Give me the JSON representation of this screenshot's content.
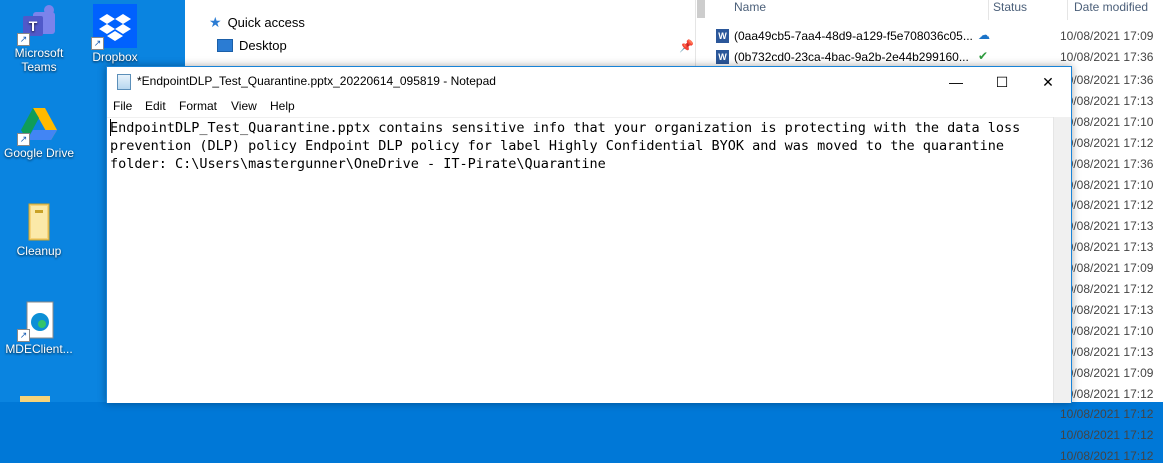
{
  "desktop": {
    "icons": [
      {
        "label": "Microsoft Teams",
        "icon": "teams-icon"
      },
      {
        "label": "Dropbox",
        "icon": "dropbox-icon"
      },
      {
        "label": "Google Drive",
        "icon": "google-drive-icon"
      },
      {
        "label": "Cleanup",
        "icon": "folder-icon"
      },
      {
        "label": "MDEClient...",
        "icon": "edge-document-icon"
      }
    ]
  },
  "explorer": {
    "nav": {
      "quick_access": "Quick access",
      "desktop": "Desktop"
    },
    "columns": {
      "name": "Name",
      "status": "Status",
      "date_modified": "Date modified"
    },
    "files": [
      {
        "name": "(0aa49cb5-7aa4-48d9-a129-f5e708036c05...",
        "status": "cloud",
        "date": "10/08/2021 17:09"
      },
      {
        "name": "(0b732cd0-23ca-4bac-9a2b-2e44b299160...",
        "status": "synced",
        "date": "10/08/2021 17:36"
      }
    ],
    "dates": [
      "10/08/2021 17:36",
      "10/08/2021 17:13",
      "10/08/2021 17:10",
      "10/08/2021 17:12",
      "10/08/2021 17:36",
      "10/08/2021 17:10",
      "10/08/2021 17:12",
      "10/08/2021 17:13",
      "10/08/2021 17:13",
      "10/08/2021 17:09",
      "10/08/2021 17:12",
      "10/08/2021 17:13",
      "10/08/2021 17:10",
      "10/08/2021 17:13",
      "10/08/2021 17:09",
      "10/08/2021 17:12",
      "10/08/2021 17:12",
      "10/08/2021 17:12",
      "10/08/2021 17:12"
    ]
  },
  "notepad": {
    "title": "*EndpointDLP_Test_Quarantine.pptx_20220614_095819 - Notepad",
    "controls": {
      "minimize": "—",
      "maximize": "☐",
      "close": "✕"
    },
    "menu": [
      "File",
      "Edit",
      "Format",
      "View",
      "Help"
    ],
    "content": "EndpointDLP_Test_Quarantine.pptx contains sensitive info that your organization is protecting with the data loss\nprevention (DLP) policy Endpoint DLP policy for label Highly Confidential BYOK and was moved to the quarantine\nfolder: C:\\Users\\mastergunner\\OneDrive - IT-Pirate\\Quarantine"
  }
}
